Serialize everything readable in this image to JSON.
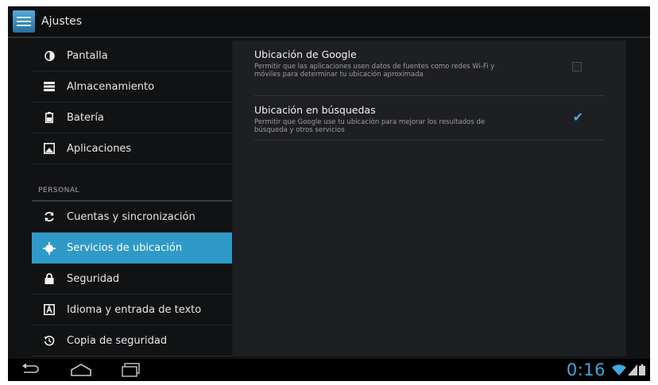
{
  "actionbar": {
    "title": "Ajustes",
    "icon": "settings-app-icon"
  },
  "sidebar": {
    "items": [
      {
        "label": "Pantalla",
        "icon": "display-icon"
      },
      {
        "label": "Almacenamiento",
        "icon": "storage-icon"
      },
      {
        "label": "Batería",
        "icon": "battery-icon"
      },
      {
        "label": "Aplicaciones",
        "icon": "apps-icon"
      },
      {
        "label": "Cuentas y sincronización",
        "icon": "sync-icon"
      },
      {
        "label": "Servicios de ubicación",
        "icon": "location-icon",
        "selected": true
      },
      {
        "label": "Seguridad",
        "icon": "lock-icon"
      },
      {
        "label": "Idioma y entrada de texto",
        "icon": "language-icon"
      },
      {
        "label": "Copia de seguridad",
        "icon": "backup-icon"
      }
    ],
    "section_personal": "PERSONAL"
  },
  "detail": {
    "prefs": [
      {
        "title": "Ubicación de Google",
        "summary": "Permitir que las aplicaciones usen datos de fuentes como redes Wi-Fi y móviles para determinar tu ubicación aproximada",
        "checked": false
      },
      {
        "title": "Ubicación en búsquedas",
        "summary": "Permitir que Google use tu ubicación para mejorar los resultados de búsqueda y otros servicios",
        "checked": true
      }
    ]
  },
  "navbar": {
    "clock": "0:16",
    "icons": [
      "back-icon",
      "home-icon",
      "recent-apps-icon",
      "wifi-icon",
      "signal-icon",
      "battery-status-icon"
    ]
  },
  "colors": {
    "accent": "#2f99c8",
    "clock": "#3fa9de",
    "background": "#111214",
    "detail_bg": "#1e1f22"
  }
}
